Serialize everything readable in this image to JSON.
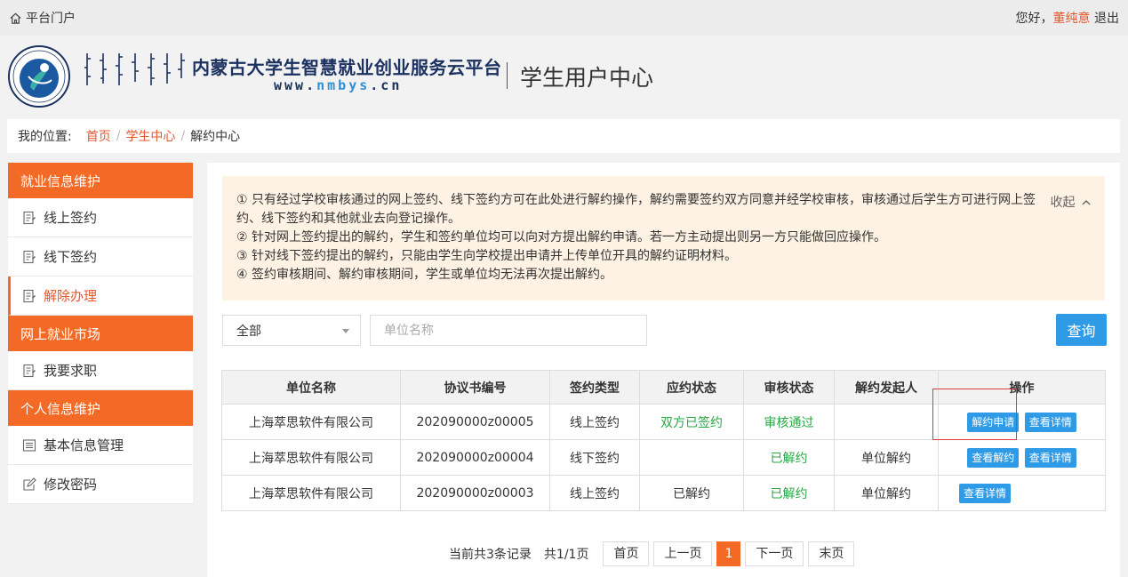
{
  "topbar": {
    "portal_label": "平台门户",
    "greeting": "您好，",
    "user_name": "董纯意",
    "logout": "退出"
  },
  "header": {
    "brand_title": "内蒙古大学生智慧就业创业服务云平台",
    "brand_url_prefix": "www.",
    "brand_url_highlight": "nmbys",
    "brand_url_suffix": ".cn",
    "center_title": "学生用户中心"
  },
  "breadcrumb": {
    "label": "我的位置:",
    "items": [
      "首页",
      "学生中心",
      "解约中心"
    ],
    "separator": "/"
  },
  "sidebar": {
    "sections": [
      {
        "title": "就业信息维护",
        "items": [
          "线上签约",
          "线下签约",
          "解除办理"
        ]
      },
      {
        "title": "网上就业市场",
        "items": [
          "我要求职"
        ]
      },
      {
        "title": "个人信息维护",
        "items": [
          "基本信息管理",
          "修改密码"
        ]
      }
    ],
    "active_item": "解除办理"
  },
  "notice": {
    "collapse_label": "收起",
    "lines": [
      "① 只有经过学校审核通过的网上签约、线下签约方可在此处进行解约操作，解约需要签约双方同意并经学校审核，审核通过后学生方可进行网上签约、线下签约和其他就业去向登记操作。",
      "② 针对网上签约提出的解约，学生和签约单位均可以向对方提出解约申请。若一方主动提出则另一方只能做回应操作。",
      "③ 针对线下签约提出的解约，只能由学生向学校提出申请并上传单位开具的解约证明材料。",
      "④ 签约审核期间、解约审核期间，学生或单位均无法再次提出解约。"
    ]
  },
  "filter": {
    "select_value": "全部",
    "search_placeholder": "单位名称",
    "query_label": "查询"
  },
  "table": {
    "headers": [
      "单位名称",
      "协议书编号",
      "签约类型",
      "应约状态",
      "审核状态",
      "解约发起人",
      "操作"
    ],
    "rows": [
      {
        "company": "上海萃思软件有限公司",
        "number": "202090000z00005",
        "type": "线上签约",
        "response": "双方已签约",
        "audit": "审核通过",
        "initiator": "",
        "actions": [
          "解约申请",
          "查看详情"
        ]
      },
      {
        "company": "上海萃思软件有限公司",
        "number": "202090000z00004",
        "type": "线下签约",
        "response": "",
        "audit": "已解约",
        "initiator": "单位解约",
        "actions": [
          "查看解约",
          "查看详情"
        ]
      },
      {
        "company": "上海萃思软件有限公司",
        "number": "202090000z00003",
        "type": "线上签约",
        "response": "已解约",
        "audit": "已解约",
        "initiator": "单位解约",
        "actions": [
          "查看详情"
        ]
      }
    ]
  },
  "pagination": {
    "info": "当前共3条记录",
    "pages": "共1/1页",
    "first": "首页",
    "prev": "上一页",
    "current": "1",
    "next": "下一页",
    "last": "末页"
  },
  "colors": {
    "accent_orange": "#f26a26",
    "link_orange": "#e8552a",
    "button_blue": "#2f9be6",
    "success_green": "#28a745",
    "notice_bg": "#fdf2e3",
    "highlight_red": "#e0393e"
  }
}
